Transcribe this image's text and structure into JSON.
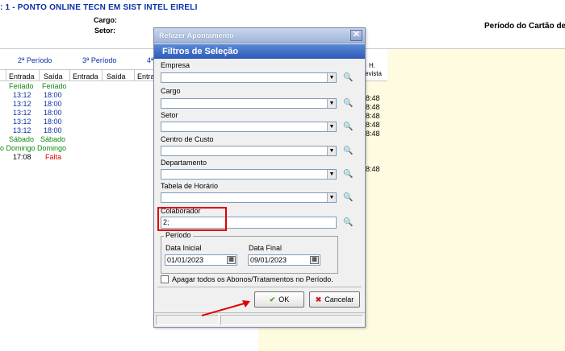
{
  "header": {
    "company": ": 1 - PONTO ONLINE TECN EM SIST INTEL EIRELI",
    "cargo_label": "Cargo:",
    "setor_label": "Setor:",
    "periodo_cartao_label": "Período do Cartão de"
  },
  "grid": {
    "periods": [
      "2ª Período",
      "3ª Período",
      "4ª"
    ],
    "subheaders": [
      "Entrada",
      "Saída",
      "Entrada",
      "Saída",
      "Entra"
    ],
    "rows": [
      {
        "entrada": "Feriado",
        "saida": "Feriado",
        "type": "green"
      },
      {
        "entrada": "13:12",
        "saida": "18:00",
        "type": "blue"
      },
      {
        "entrada": "13:12",
        "saida": "18:00",
        "type": "blue"
      },
      {
        "entrada": "13:12",
        "saida": "18:00",
        "type": "blue"
      },
      {
        "entrada": "13:12",
        "saida": "18:00",
        "type": "blue"
      },
      {
        "entrada": "13:12",
        "saida": "18:00",
        "type": "blue"
      },
      {
        "entrada": "Sábado",
        "saida": "Sábado",
        "type": "green"
      },
      {
        "entrada": "o Domingo",
        "saida": "Domingo",
        "type": "green"
      },
      {
        "entrada": "17:08",
        "saida": "Falta",
        "type": "mixed"
      }
    ],
    "h_header": "H.",
    "h_sub": "evista",
    "right_times": [
      "8:48",
      "8:48",
      "8:48",
      "8:48",
      "8:48",
      "",
      "",
      "",
      "8:48"
    ]
  },
  "dialog": {
    "title": "Refazer Apontamento",
    "close_glyph": "✕",
    "banner": "Filtros de Seleção",
    "fields": {
      "empresa": "Empresa",
      "cargo": "Cargo",
      "setor": "Setor",
      "centro_custo": "Centro de Custo",
      "departamento": "Departamento",
      "tabela_horario": "Tabela de Horário",
      "colaborador": "Colaborador"
    },
    "colaborador_value": "2;",
    "periodo": {
      "title": "Período",
      "data_inicial_label": "Data Inicial",
      "data_inicial": "01/01/2023",
      "data_final_label": "Data Final",
      "data_final": "09/01/2023"
    },
    "apagar_label": "Apagar todos os Abonos/Tratamentos no Período.",
    "ok_label": "OK",
    "cancel_label": "Cancelar",
    "ok_glyph": "✔",
    "cancel_glyph": "✖",
    "combo_arrow_glyph": "▼",
    "lookup_glyph": "🔍",
    "date_btn_glyph": "▦"
  },
  "colors": {
    "company_blue": "#0b2fa8",
    "green_text": "#0e8a0e",
    "red_text": "#e00000",
    "banner_blue": "#2d5ab8",
    "highlight_red": "#e00000",
    "yellow_panel": "#fffbe0"
  }
}
